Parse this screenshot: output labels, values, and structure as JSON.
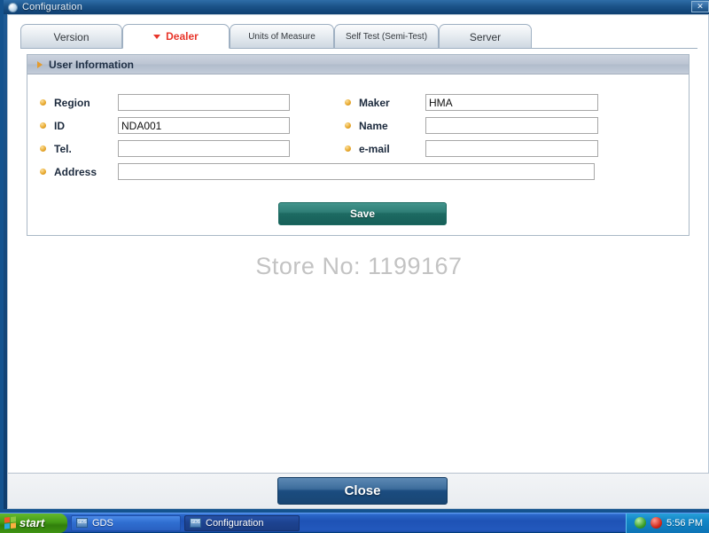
{
  "window": {
    "title": "Configuration",
    "icon": "window-icon",
    "close_label": "✕"
  },
  "tabs": [
    {
      "label": "Version",
      "active": false
    },
    {
      "label": "Dealer",
      "active": true
    },
    {
      "label": "Units of Measure",
      "active": false
    },
    {
      "label": "Self Test (Semi-Test)",
      "active": false
    },
    {
      "label": "Server",
      "active": false
    }
  ],
  "panel": {
    "title": "User Information",
    "arrow_icon": "triangle-right-icon"
  },
  "form": {
    "fields": {
      "region": {
        "label": "Region",
        "value": "",
        "placeholder": ""
      },
      "id": {
        "label": "ID",
        "value": "NDA001",
        "placeholder": ""
      },
      "tel": {
        "label": "Tel.",
        "value": "",
        "placeholder": ""
      },
      "address": {
        "label": "Address",
        "value": "",
        "placeholder": ""
      },
      "maker": {
        "label": "Maker",
        "value": "HMA",
        "placeholder": ""
      },
      "name": {
        "label": "Name",
        "value": "",
        "placeholder": ""
      },
      "email": {
        "label": "e-mail",
        "value": "",
        "placeholder": ""
      }
    },
    "save_label": "Save"
  },
  "watermark": "Store No: 1199167",
  "footer": {
    "close_label": "Close"
  },
  "taskbar": {
    "start_label": "start",
    "items": [
      {
        "label": "GDS",
        "icon_text": "GDS",
        "active": false
      },
      {
        "label": "Configuration",
        "icon_text": "GDS",
        "active": true
      }
    ],
    "tray": {
      "icons": [
        "network-icon",
        "shield-alert-icon"
      ],
      "clock": "5:56 PM"
    }
  },
  "colors": {
    "accent_red": "#e8352a",
    "save_teal": "#1d6a62",
    "close_blue": "#1b4c80",
    "bullet_amber": "#e7a72b",
    "titlebar_blue": "#1b5389"
  }
}
